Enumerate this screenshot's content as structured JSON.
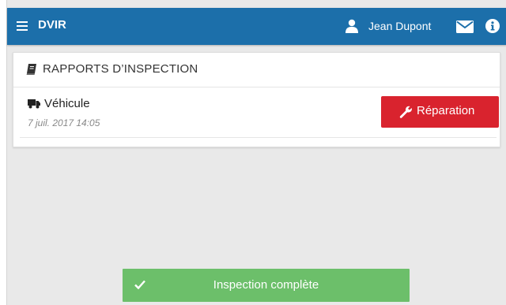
{
  "header": {
    "title": "DVIR",
    "user_name": "Jean Dupont",
    "icons": [
      "menu-icon",
      "user-icon",
      "envelope-icon",
      "info-icon"
    ],
    "bar_color": "#1c6faa"
  },
  "reports": {
    "title": "RAPPORTS D’INSPECTION",
    "title_icon": "book-icon",
    "items": [
      {
        "label": "Véhicule",
        "icon": "truck-icon",
        "date": "7 juil. 2017 14:05",
        "action_label": "Réparation",
        "action_icon": "wrench-icon",
        "action_color": "#d9232e"
      }
    ]
  },
  "toast": {
    "message": "Inspection complète",
    "icon": "check-icon",
    "color": "#6cbf6a"
  }
}
